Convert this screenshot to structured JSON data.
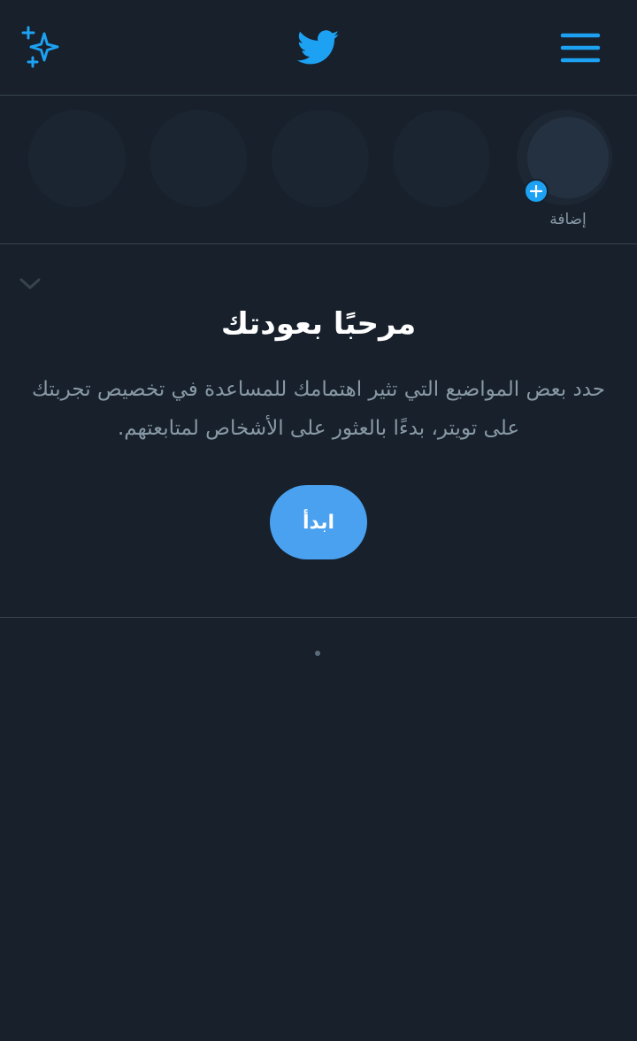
{
  "header": {
    "left_icon": "sparkle-icon",
    "logo_icon": "twitter-bird-icon",
    "right_icon": "hamburger-menu-icon",
    "accent_color": "#1da1f2"
  },
  "fleets": {
    "add_label": "إضافة",
    "add_icon": "plus-icon"
  },
  "welcome": {
    "title": "مرحبًا بعودتك",
    "body": "حدد بعض المواضيع التي تثير اهتمامك للمساعدة في تخصيص تجربتك على تويتر، بدءًا بالعثور على الأشخاص لمتابعتهم.",
    "start_label": "ابدأ",
    "collapse_icon": "chevron-down-icon"
  },
  "colors": {
    "background": "#17202b",
    "divider": "#38444d",
    "secondary_text": "#8899a6",
    "button": "#4aa1f0"
  }
}
